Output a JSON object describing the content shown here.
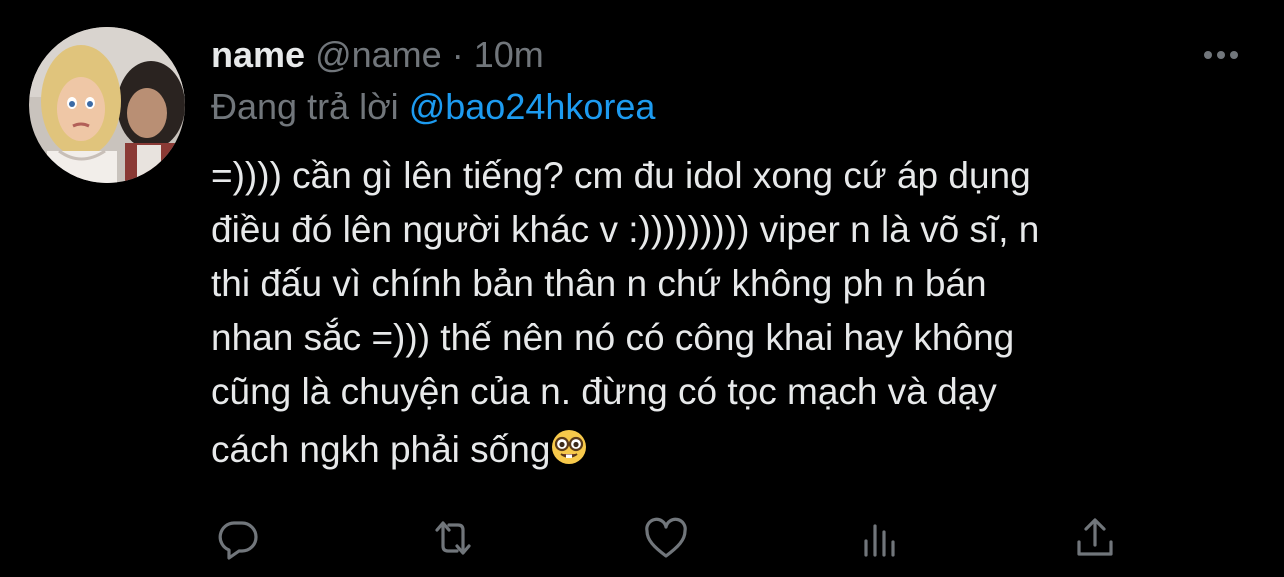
{
  "author": {
    "display_name": "name",
    "handle": "@name",
    "separator": "·",
    "timestamp": "10m",
    "avatar_icon": "avatar-image"
  },
  "reply": {
    "prefix": "Đang trả lời",
    "mention": "@bao24hkorea"
  },
  "tweet": {
    "lines": [
      "=)))) cần gì lên tiếng? cm đu idol xong cứ áp dụng",
      "điều đó lên người khác v :))))))))) viper n là võ sĩ, n",
      "thi đấu vì chính bản thân n chứ không ph n bán",
      "nhan sắc =))) thế nên nó có công khai hay không",
      "cũng là chuyện của n. đừng có tọc mạch và dạy",
      "cách ngkh phải sống"
    ],
    "emoji": "nerd-face-emoji"
  },
  "actions": {
    "reply_icon": "reply-icon",
    "retweet_icon": "retweet-icon",
    "like_icon": "heart-icon",
    "analytics_icon": "analytics-icon",
    "share_icon": "share-icon"
  },
  "colors": {
    "background": "#000000",
    "text": "#e7e9ea",
    "muted": "#71767b",
    "accent": "#1d9bf0"
  }
}
